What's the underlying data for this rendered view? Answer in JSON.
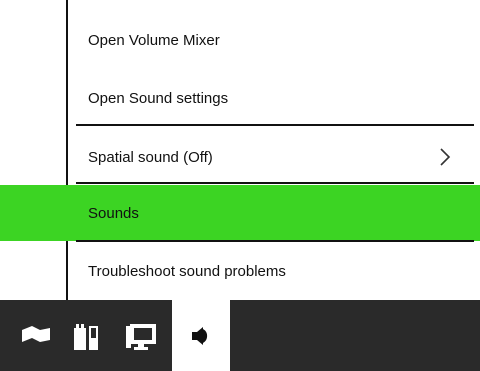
{
  "context_menu": {
    "items": [
      {
        "label": "Open Volume Mixer"
      },
      {
        "label": "Open Sound settings"
      },
      {
        "label": "Spatial sound (Off)",
        "has_submenu": true
      },
      {
        "label": "Sounds",
        "highlighted": true
      },
      {
        "label": "Troubleshoot sound problems"
      }
    ],
    "highlight_color": "#3cd423"
  },
  "taskbar": {
    "background": "#2a2a2a",
    "tray_icons": [
      "flag-icon",
      "battery-icon",
      "network-icon",
      "volume-icon"
    ]
  }
}
